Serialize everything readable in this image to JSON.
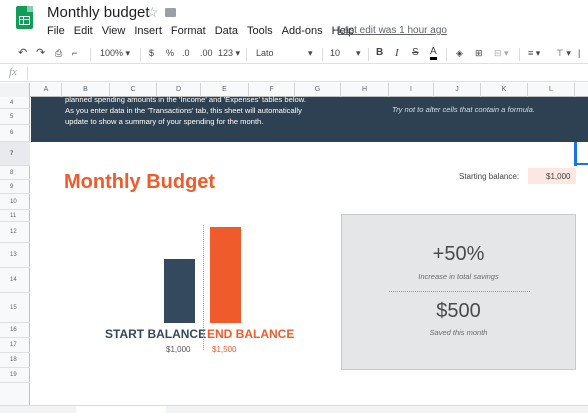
{
  "app": {
    "title": "Monthly budget",
    "last_edit": "Last edit was 1 hour ago",
    "menu": [
      "File",
      "Edit",
      "View",
      "Insert",
      "Format",
      "Data",
      "Tools",
      "Add-ons",
      "Help"
    ]
  },
  "toolbar": {
    "zoom": "100%",
    "currency": "$",
    "percent": "%",
    "dec_less": ".0",
    "dec_more": ".00",
    "more_formats": "123",
    "font": "Lato",
    "font_size": "10",
    "bold": "B",
    "italic": "I",
    "strike": "S",
    "font_color": "A"
  },
  "formula_bar": {
    "label": "fx",
    "value": ""
  },
  "columns": [
    "A",
    "B",
    "C",
    "D",
    "E",
    "F",
    "G",
    "H",
    "I",
    "J",
    "K",
    "L"
  ],
  "rows": [
    "4",
    "5",
    "6",
    "7",
    "8",
    "9",
    "10",
    "11",
    "12",
    "13",
    "14",
    "15",
    "16",
    "17",
    "18",
    "19"
  ],
  "sheet": {
    "instructions": [
      "planned spending amounts in the 'Income' and 'Expenses' tables below.",
      "As you enter data in the 'Transactions' tab, this sheet will automatically",
      "update to show a summary of your spending for the month."
    ],
    "note": "Try not to alter cells that contain a formula.",
    "title": "Monthly Budget",
    "starting_balance_label": "Starting balance:",
    "starting_balance_value": "$1,000"
  },
  "chart_data": {
    "type": "bar",
    "categories": [
      "START BALANCE",
      "END BALANCE"
    ],
    "values": [
      1000,
      1500
    ],
    "value_labels": [
      "$1,000",
      "$1,500"
    ],
    "colors": [
      "#34495e",
      "#f05b2b"
    ]
  },
  "summary": {
    "stat1_value": "+50%",
    "stat1_label": "Increase in total savings",
    "stat2_value": "$500",
    "stat2_label": "Saved this month"
  },
  "colors": {
    "accent": "#f05b2b",
    "navy": "#2e4152",
    "bar_dark": "#34495e",
    "sheets_green": "#0f9d58"
  }
}
